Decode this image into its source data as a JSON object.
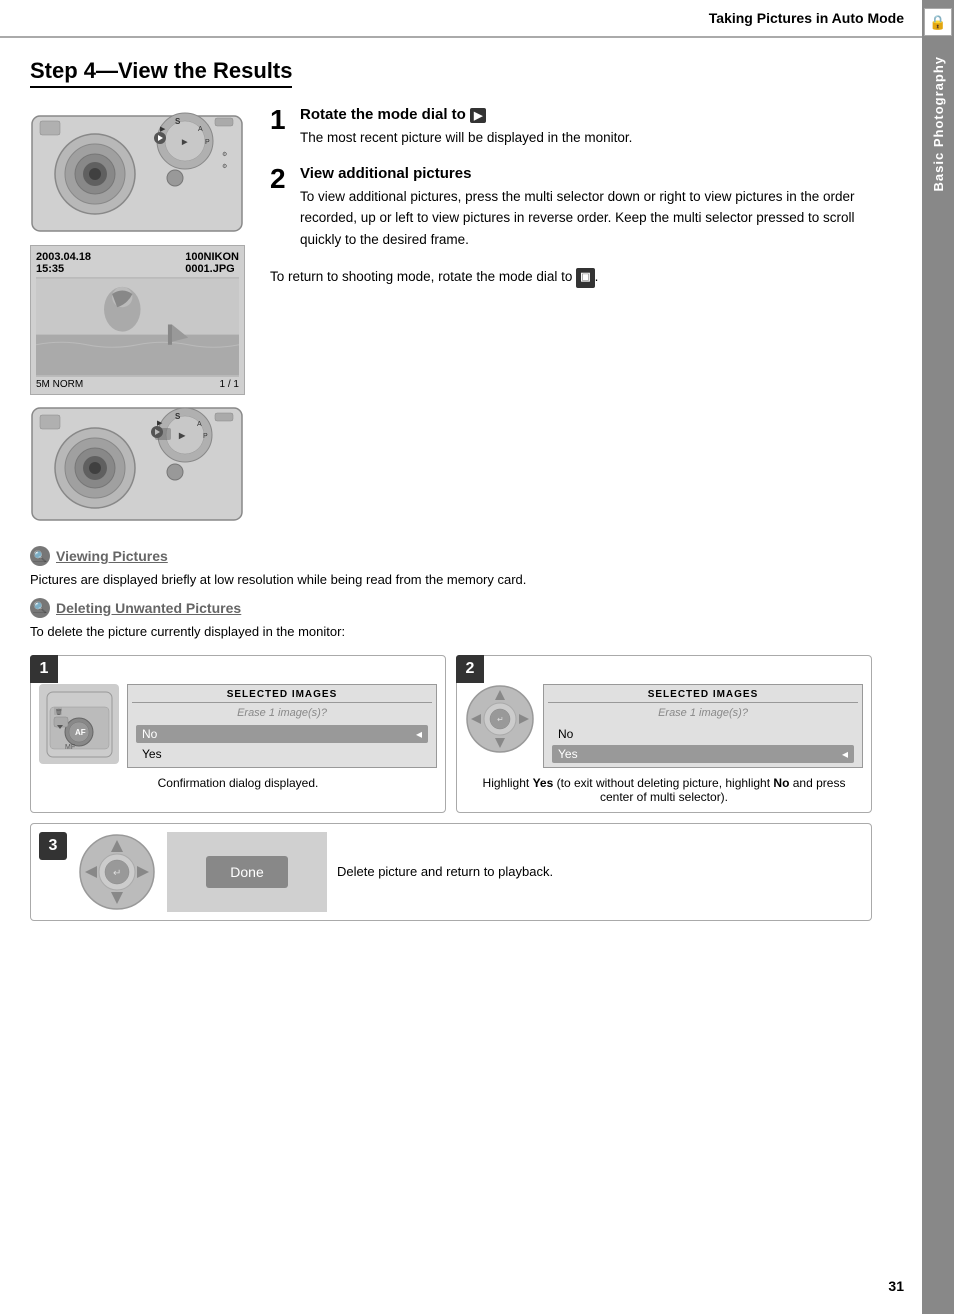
{
  "header": {
    "title": "Taking Pictures in Auto Mode"
  },
  "step_heading": "Step 4—View the Results",
  "step1": {
    "number": "1",
    "title": "Rotate the mode dial to",
    "title_icon": "▶",
    "desc": "The most recent picture will be displayed in the monitor."
  },
  "step2": {
    "number": "2",
    "title": "View additional pictures",
    "desc": "To view additional pictures, press the multi selector down or right to view pictures in the order recorded, up or left to view pictures in reverse order.  Keep the multi selector pressed to scroll quickly to the desired frame."
  },
  "return_note": "To return to shooting mode, rotate the mode dial to",
  "return_icon": "▣",
  "viewing_pictures": {
    "heading": "Viewing Pictures",
    "text": "Pictures are displayed briefly at low resolution while being read from the memory card."
  },
  "deleting_pictures": {
    "heading": "Deleting Unwanted Pictures",
    "text": "To delete the picture currently displayed in the monitor:"
  },
  "delete_steps": {
    "step1": {
      "num": "1",
      "caption": "Confirmation dialog displayed.",
      "dialog_title": "SELECTED IMAGES",
      "erase_text": "Erase  1 image(s)?",
      "option_no": "No",
      "option_yes": "Yes"
    },
    "step2": {
      "num": "2",
      "caption_bold": "Yes",
      "caption_before": "Highlight ",
      "caption_after": " (to exit without deleting picture, highlight ",
      "no_bold": "No",
      "caption_end": " and press center of multi selector).",
      "dialog_title": "SELECTED IMAGES",
      "erase_text": "Erase  1 image(s)?",
      "option_no": "No",
      "option_yes": "Yes"
    },
    "step3": {
      "num": "3",
      "text": "Delete picture and return to playback.",
      "done_label": "Done"
    }
  },
  "camera_screen": {
    "date": "2003.04.18",
    "time": "15:35",
    "folder": "100NIKON",
    "filename": "0001.JPG",
    "quality": "5M NORM",
    "frame_info": "1 / 1"
  },
  "sidebar": {
    "icon": "🔒",
    "label": "Basic Photography"
  },
  "page_number": "31"
}
